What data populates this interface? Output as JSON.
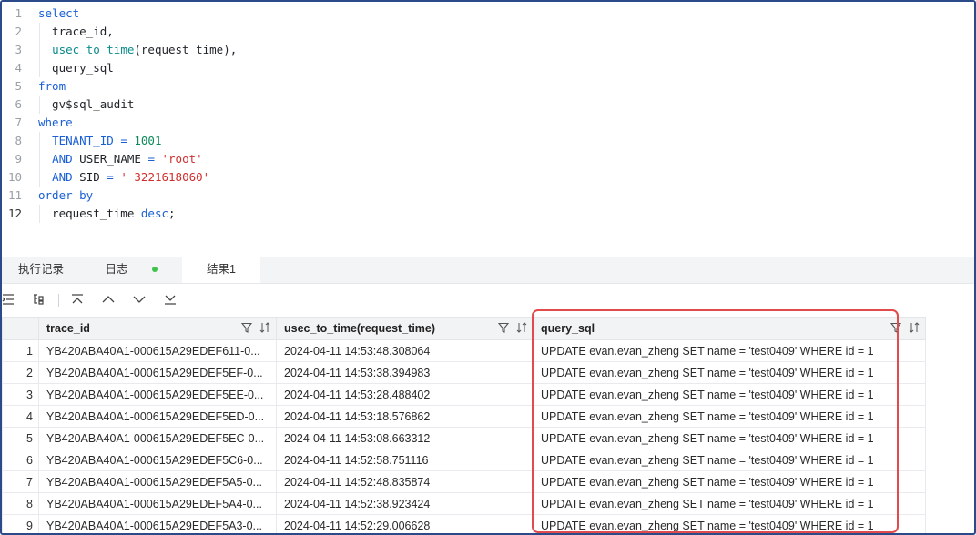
{
  "editor": {
    "lines": [
      {
        "n": "1",
        "tokens": [
          {
            "t": "select",
            "c": "kw"
          }
        ]
      },
      {
        "n": "2",
        "tokens": [
          {
            "t": "  trace_id,",
            "c": ""
          }
        ]
      },
      {
        "n": "3",
        "tokens": [
          {
            "t": "  ",
            "c": ""
          },
          {
            "t": "usec_to_time",
            "c": "fn"
          },
          {
            "t": "(request_time),",
            "c": ""
          }
        ]
      },
      {
        "n": "4",
        "tokens": [
          {
            "t": "  query_sql",
            "c": ""
          }
        ]
      },
      {
        "n": "5",
        "tokens": [
          {
            "t": "from",
            "c": "kw"
          }
        ]
      },
      {
        "n": "6",
        "tokens": [
          {
            "t": "  gv$sql_audit",
            "c": ""
          }
        ]
      },
      {
        "n": "7",
        "tokens": [
          {
            "t": "where",
            "c": "kw"
          }
        ]
      },
      {
        "n": "8",
        "tokens": [
          {
            "t": "  ",
            "c": ""
          },
          {
            "t": "TENANT_ID",
            "c": "kw"
          },
          {
            "t": " = ",
            "c": "op"
          },
          {
            "t": "1001",
            "c": "num"
          }
        ]
      },
      {
        "n": "9",
        "tokens": [
          {
            "t": "  ",
            "c": ""
          },
          {
            "t": "AND",
            "c": "kw"
          },
          {
            "t": " USER_NAME ",
            "c": ""
          },
          {
            "t": "=",
            "c": "op"
          },
          {
            "t": " ",
            "c": ""
          },
          {
            "t": "'root'",
            "c": "str"
          }
        ]
      },
      {
        "n": "10",
        "tokens": [
          {
            "t": "  ",
            "c": ""
          },
          {
            "t": "AND",
            "c": "kw"
          },
          {
            "t": " SID ",
            "c": ""
          },
          {
            "t": "=",
            "c": "op"
          },
          {
            "t": " ",
            "c": ""
          },
          {
            "t": "' 3221618060'",
            "c": "str"
          }
        ]
      },
      {
        "n": "11",
        "tokens": [
          {
            "t": "order by",
            "c": "kw"
          }
        ]
      },
      {
        "n": "12",
        "tokens": [
          {
            "t": "  request_time ",
            "c": ""
          },
          {
            "t": "desc",
            "c": "kw"
          },
          {
            "t": ";",
            "c": ""
          }
        ]
      }
    ]
  },
  "tabs": {
    "history": "执行记录",
    "log": "日志",
    "result": "结果1"
  },
  "toolbar": {
    "icons": [
      "expand-rows-icon",
      "tree-structure-icon",
      "first-page-icon",
      "previous-page-icon",
      "next-page-icon",
      "last-page-icon"
    ]
  },
  "table": {
    "columns": [
      "trace_id",
      "usec_to_time(request_time)",
      "query_sql"
    ],
    "rows": [
      {
        "idx": "1",
        "trace_id": "YB420ABA40A1-000615A29EDEF611-0...",
        "time": "2024-04-11 14:53:48.308064",
        "sql": "UPDATE evan.evan_zheng SET name = 'test0409' WHERE id = 1"
      },
      {
        "idx": "2",
        "trace_id": "YB420ABA40A1-000615A29EDEF5EF-0...",
        "time": "2024-04-11 14:53:38.394983",
        "sql": "UPDATE evan.evan_zheng SET name = 'test0409' WHERE id = 1"
      },
      {
        "idx": "3",
        "trace_id": "YB420ABA40A1-000615A29EDEF5EE-0...",
        "time": "2024-04-11 14:53:28.488402",
        "sql": "UPDATE evan.evan_zheng SET name = 'test0409' WHERE id = 1"
      },
      {
        "idx": "4",
        "trace_id": "YB420ABA40A1-000615A29EDEF5ED-0...",
        "time": "2024-04-11 14:53:18.576862",
        "sql": "UPDATE evan.evan_zheng SET name = 'test0409' WHERE id = 1"
      },
      {
        "idx": "5",
        "trace_id": "YB420ABA40A1-000615A29EDEF5EC-0...",
        "time": "2024-04-11 14:53:08.663312",
        "sql": "UPDATE evan.evan_zheng SET name = 'test0409' WHERE id = 1"
      },
      {
        "idx": "6",
        "trace_id": "YB420ABA40A1-000615A29EDEF5C6-0...",
        "time": "2024-04-11 14:52:58.751116",
        "sql": "UPDATE evan.evan_zheng SET name = 'test0409' WHERE id = 1"
      },
      {
        "idx": "7",
        "trace_id": "YB420ABA40A1-000615A29EDEF5A5-0...",
        "time": "2024-04-11 14:52:48.835874",
        "sql": "UPDATE evan.evan_zheng SET name = 'test0409' WHERE id = 1"
      },
      {
        "idx": "8",
        "trace_id": "YB420ABA40A1-000615A29EDEF5A4-0...",
        "time": "2024-04-11 14:52:38.923424",
        "sql": "UPDATE evan.evan_zheng SET name = 'test0409' WHERE id = 1"
      },
      {
        "idx": "9",
        "trace_id": "YB420ABA40A1-000615A29EDEF5A3-0...",
        "time": "2024-04-11 14:52:29.006628",
        "sql": "UPDATE evan.evan_zheng SET name = 'test0409' WHERE id = 1"
      }
    ]
  },
  "colors": {
    "keyword": "#1a5fd6",
    "function": "#0b8b8b",
    "string": "#d22d2d",
    "number": "#0b8b5a",
    "highlight_border": "#e24b4b",
    "status_dot": "#41c24d",
    "frame_border": "#2b4a8a"
  }
}
